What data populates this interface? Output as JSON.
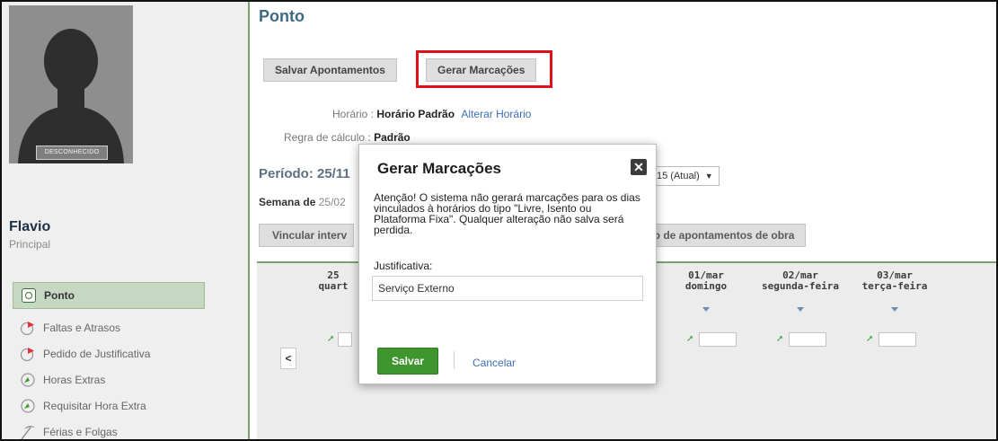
{
  "user": {
    "status_tag": "DESCONHECIDO",
    "name": "Flavio",
    "role": "Principal"
  },
  "sidebar": {
    "items": [
      {
        "label": "Ponto",
        "icon": "ponto-icon",
        "active": true
      },
      {
        "label": "Faltas e Atrasos",
        "icon": "clock-flag-icon"
      },
      {
        "label": "Pedido de Justificativa",
        "icon": "clock-flag-icon"
      },
      {
        "label": "Horas Extras",
        "icon": "clock-plus-icon"
      },
      {
        "label": "Requisitar Hora Extra",
        "icon": "clock-plus-icon"
      },
      {
        "label": "Férias e Folgas",
        "icon": "beach-icon"
      }
    ]
  },
  "main": {
    "title": "Ponto",
    "btn_salvar_apontamentos": "Salvar Apontamentos",
    "btn_gerar_marcacoes": "Gerar Marcações",
    "horario_label": "Horário :",
    "horario_value": "Horário Padrão",
    "alterar_horario": "Alterar Horário",
    "regra_label": "Regra de cálculo :",
    "regra_value": "Padrão",
    "periodo_label": "Período: 25/11",
    "periodo_select": "15 (Atual)",
    "semana_label": "Semana de",
    "semana_value": "25/02",
    "btn_vincular_intervalo": "Vincular interv",
    "btn_vincular_intervalo_obra": "valo de apontamentos de obra",
    "days": [
      {
        "date": "25",
        "weekday": "quart"
      },
      {
        "date": "01/mar",
        "weekday": "domingo"
      },
      {
        "date": "02/mar",
        "weekday": "segunda-feira"
      },
      {
        "date": "03/mar",
        "weekday": "terça-feira"
      }
    ],
    "nav_prev": "<"
  },
  "modal": {
    "title": "Gerar Marcações",
    "message": "Atenção! O sistema não gerará marcações para os dias vinculados à horários do tipo \"Livre, Isento ou Plataforma Fixa\". Qualquer alteração não salva será perdida.",
    "justificativa_label": "Justificativa:",
    "justificativa_value": "Serviço Externo",
    "save_label": "Salvar",
    "cancel_label": "Cancelar"
  },
  "colors": {
    "accent_green": "#3f962e",
    "title_blue": "#3c6a82",
    "highlight_red": "#e0101a",
    "link_blue": "#3b6fb6"
  }
}
